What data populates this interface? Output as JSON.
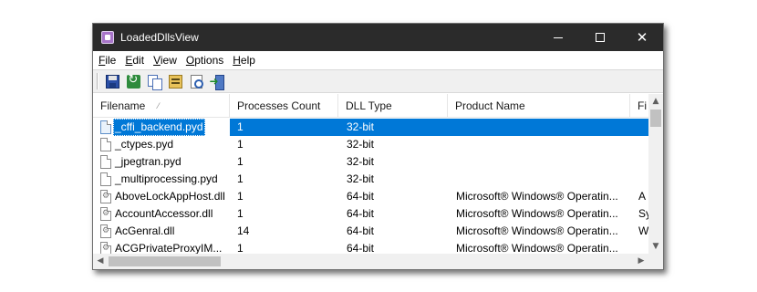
{
  "window": {
    "title": "LoadedDllsView",
    "controls": {
      "minimize": "minimize",
      "maximize": "maximize",
      "close": "✕"
    }
  },
  "menu": [
    {
      "accel": "F",
      "rest": "ile"
    },
    {
      "accel": "E",
      "rest": "dit"
    },
    {
      "accel": "V",
      "rest": "iew"
    },
    {
      "accel": "O",
      "rest": "ptions"
    },
    {
      "accel": "H",
      "rest": "elp"
    }
  ],
  "toolbar": {
    "buttons": [
      "save-icon",
      "refresh-icon",
      "copy-icon",
      "properties-icon",
      "find-icon",
      "exit-icon"
    ]
  },
  "table": {
    "columns": [
      "Filename",
      "Processes Count",
      "DLL Type",
      "Product Name",
      "Fi"
    ],
    "sort_indicator": "⁄",
    "rows": [
      {
        "filename": "_cffi_backend.pyd",
        "count": "1",
        "type": "32-bit",
        "product": "",
        "extra": "",
        "icon": "file",
        "selected": true
      },
      {
        "filename": "_ctypes.pyd",
        "count": "1",
        "type": "32-bit",
        "product": "",
        "extra": "",
        "icon": "file"
      },
      {
        "filename": "_jpegtran.pyd",
        "count": "1",
        "type": "32-bit",
        "product": "",
        "extra": "",
        "icon": "file"
      },
      {
        "filename": "_multiprocessing.pyd",
        "count": "1",
        "type": "32-bit",
        "product": "",
        "extra": "",
        "icon": "file"
      },
      {
        "filename": "AboveLockAppHost.dll",
        "count": "1",
        "type": "64-bit",
        "product": "Microsoft® Windows® Operatin...",
        "extra": "A",
        "icon": "dll"
      },
      {
        "filename": "AccountAccessor.dll",
        "count": "1",
        "type": "64-bit",
        "product": "Microsoft® Windows® Operatin...",
        "extra": "Sy",
        "icon": "dll"
      },
      {
        "filename": "AcGenral.dll",
        "count": "14",
        "type": "64-bit",
        "product": "Microsoft® Windows® Operatin...",
        "extra": "W",
        "icon": "dll"
      },
      {
        "filename": "ACGPrivateProxyIM...",
        "count": "1",
        "type": "64-bit",
        "product": "Microsoft® Windows® Operatin...",
        "extra": "",
        "icon": "dll"
      }
    ]
  },
  "scrollbars": {
    "up": "▲",
    "down": "▼",
    "left": "◀",
    "right": "▶"
  }
}
